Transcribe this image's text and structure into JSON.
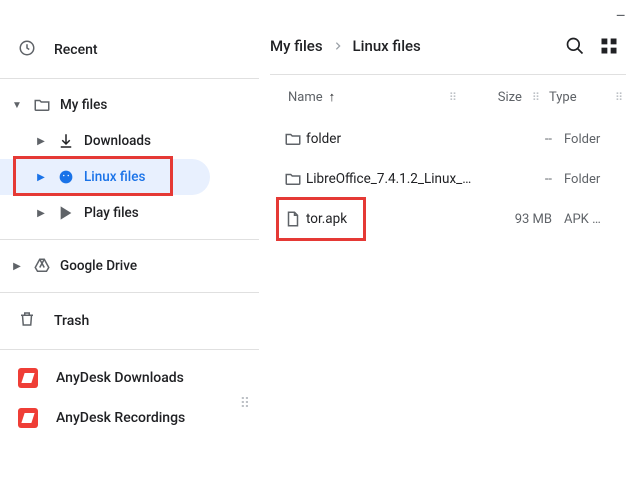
{
  "window": {
    "minimize": "–"
  },
  "sidebar": {
    "recent": "Recent",
    "myfiles": "My files",
    "downloads": "Downloads",
    "linuxfiles": "Linux files",
    "playfiles": "Play files",
    "gdrive": "Google Drive",
    "trash": "Trash",
    "anydesk_dl": "AnyDesk Downloads",
    "anydesk_rec": "AnyDesk Recordings"
  },
  "breadcrumb": {
    "root": "My files",
    "current": "Linux files"
  },
  "columns": {
    "name": "Name",
    "sort_arrow": "↑",
    "size": "Size",
    "type": "Type"
  },
  "files": [
    {
      "name": "folder",
      "size": "--",
      "type": "Folder",
      "icon": "folder"
    },
    {
      "name": "LibreOffice_7.4.1.2_Linux_…",
      "size": "--",
      "type": "Folder",
      "icon": "folder"
    },
    {
      "name": "tor.apk",
      "size": "93 MB",
      "type": "APK …",
      "icon": "file"
    }
  ],
  "grip": "⠿"
}
